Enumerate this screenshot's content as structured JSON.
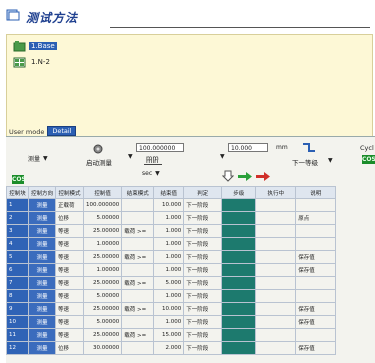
{
  "header": {
    "title": "测试方法"
  },
  "tree": {
    "items": [
      {
        "label": "1.Base",
        "selected": true
      },
      {
        "label": "1.N-2",
        "selected": false
      }
    ]
  },
  "tabs": {
    "static_label": "User mode",
    "active_tab": "Detail"
  },
  "toolbar": {
    "mode_combo": "测量",
    "run_label": "启动测量",
    "speed_value": "100.000000",
    "speed_unit": "mm",
    "speed_unit2": "min",
    "time_unit": "sec",
    "step_value": "10.000",
    "step_unit": "mm",
    "next_label": "下一等级",
    "cycle_label": "Cycl",
    "green_left": "COS",
    "green_right": "COS"
  },
  "table": {
    "columns": [
      "控制块",
      "控制方向",
      "控制模式",
      "控制值",
      "结束模式",
      "结束值",
      "判定",
      "步级",
      "执行中",
      "说明"
    ],
    "rows": [
      [
        "1",
        "测量",
        "正载荷",
        "100.000000",
        "",
        "10.000",
        "下一阶段",
        "",
        "",
        ""
      ],
      [
        "2",
        "测量",
        "位移",
        "5.00000",
        "",
        "1.000",
        "下一阶段",
        "",
        "",
        "原点"
      ],
      [
        "3",
        "测量",
        "等速",
        "25.00000",
        "载荷 >=",
        "1.000",
        "下一阶段",
        "",
        "",
        ""
      ],
      [
        "4",
        "测量",
        "等速",
        "1.00000",
        "",
        "1.000",
        "下一阶段",
        "",
        "",
        ""
      ],
      [
        "5",
        "测量",
        "等速",
        "25.00000",
        "载荷 >=",
        "1.000",
        "下一阶段",
        "",
        "",
        "保存值"
      ],
      [
        "6",
        "测量",
        "等速",
        "1.00000",
        "",
        "1.000",
        "下一阶段",
        "",
        "",
        "保存值"
      ],
      [
        "7",
        "测量",
        "等速",
        "25.00000",
        "载荷 >=",
        "5.000",
        "下一阶段",
        "",
        "",
        ""
      ],
      [
        "8",
        "测量",
        "等速",
        "5.00000",
        "",
        "1.000",
        "下一阶段",
        "",
        "",
        ""
      ],
      [
        "9",
        "测量",
        "等速",
        "25.00000",
        "载荷 >=",
        "10.000",
        "下一阶段",
        "",
        "",
        "保存值"
      ],
      [
        "10",
        "测量",
        "等速",
        "5.00000",
        "",
        "1.000",
        "下一阶段",
        "",
        "",
        "保存值"
      ],
      [
        "11",
        "测量",
        "等速",
        "25.00000",
        "载荷 >=",
        "15.000",
        "下一阶段",
        "",
        "",
        ""
      ],
      [
        "12",
        "测量",
        "位移",
        "30.00000",
        "",
        "2.000",
        "下一阶段",
        "",
        "",
        "保存值"
      ]
    ]
  }
}
